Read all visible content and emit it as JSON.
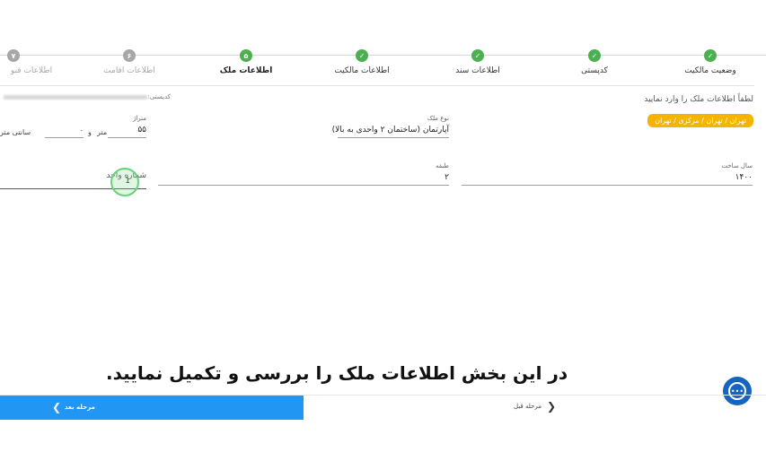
{
  "stepper": {
    "steps": [
      {
        "label": "وضعیت مالکیت",
        "state": "done",
        "marker": "✓"
      },
      {
        "label": "کدپستی",
        "state": "done",
        "marker": "✓"
      },
      {
        "label": "اطلاعات سند",
        "state": "done",
        "marker": "✓"
      },
      {
        "label": "اطلاعات مالکیت",
        "state": "done",
        "marker": "✓"
      },
      {
        "label": "اطلاعات ملک",
        "state": "active",
        "marker": "۵"
      },
      {
        "label": "اطلاعات اقامت",
        "state": "pending",
        "marker": "۶"
      },
      {
        "label": "اطلاعات قبو",
        "state": "pending",
        "marker": "۷"
      }
    ]
  },
  "intro": {
    "text": "لطفاً اطلاعات ملک را وارد نمایید",
    "location": "تهران / تهران / مرکزی / تهران",
    "postal_label": "کدپستی:"
  },
  "form": {
    "property_type": {
      "label": "نوع ملک",
      "value": "آپارتمان (ساختمان ۲ واحدی به بالا)"
    },
    "area": {
      "label": "متراژ",
      "value": "۵۵",
      "unit_meter": "متر",
      "and": "و",
      "extra_value": "۰",
      "unit_cm": "سانتی متر"
    },
    "build_year": {
      "label": "سال ساخت",
      "value": "۱۴۰۰"
    },
    "floor": {
      "label": "طبقه",
      "value": "۲"
    },
    "unit_number": {
      "label": "شماره واحد",
      "value": "1"
    }
  },
  "caption": "در این بخش اطلاعات ملک را بررسی و تکمیل نمایید.",
  "footer": {
    "next_label": "مرحله بعد",
    "prev_label": "مرحله قبل"
  },
  "colors": {
    "primary": "#2196f3",
    "success": "#4caf50",
    "badge": "#f5b400",
    "chat": "#1565c0"
  }
}
